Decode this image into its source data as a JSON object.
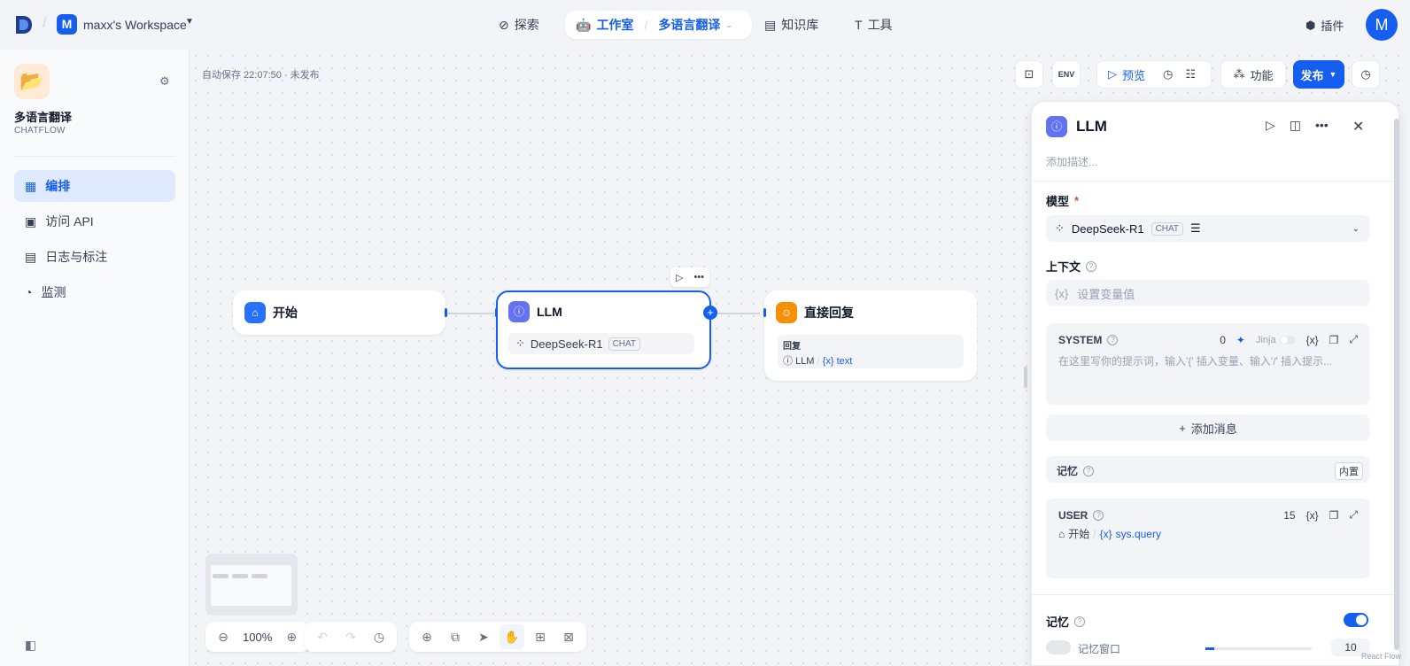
{
  "header": {
    "workspace_initial": "M",
    "workspace_name": "maxx's Workspace",
    "nav": {
      "explore": "探索",
      "studio": "工作室",
      "app_name": "多语言翻译",
      "knowledge": "知识库",
      "tools": "工具"
    },
    "plugins": "插件",
    "user_initial": "M"
  },
  "sidebar": {
    "app_name": "多语言翻译",
    "app_type": "CHATFLOW",
    "items": [
      {
        "label": "编排",
        "active": true
      },
      {
        "label": "访问 API"
      },
      {
        "label": "日志与标注"
      },
      {
        "label": "监测"
      }
    ]
  },
  "canvas": {
    "autosave": "自动保存 22:07:50 · 未发布",
    "toolbar": {
      "env": "ENV",
      "preview": "预览",
      "features": "功能",
      "publish": "发布"
    },
    "nodes": {
      "start": {
        "title": "开始"
      },
      "llm": {
        "title": "LLM",
        "model": "DeepSeek-R1",
        "model_badge": "CHAT"
      },
      "reply": {
        "title": "直接回复",
        "field_label": "回复",
        "source_node": "LLM",
        "variable": "text"
      }
    },
    "zoom": "100%"
  },
  "panel": {
    "title": "LLM",
    "description_placeholder": "添加描述...",
    "model_label": "模型",
    "required_mark": "*",
    "model_name": "DeepSeek-R1",
    "model_badge": "CHAT",
    "context_label": "上下文",
    "context_placeholder": "设置变量值",
    "system": {
      "role": "SYSTEM",
      "count": "0",
      "jinja": "Jinja",
      "placeholder": "在这里写你的提示词，输入'{' 插入变量、输入'/' 插入提示..."
    },
    "add_message": "添加消息",
    "memory_row": {
      "label": "记忆",
      "tag": "内置"
    },
    "user": {
      "role": "USER",
      "count": "15",
      "source_node": "开始",
      "variable": "sys.query"
    },
    "memory_section_label": "记忆",
    "memory_enabled": true,
    "memory_window_label": "记忆窗口",
    "memory_window_value": "10"
  },
  "footer": {
    "react_flow": "React Flow"
  }
}
